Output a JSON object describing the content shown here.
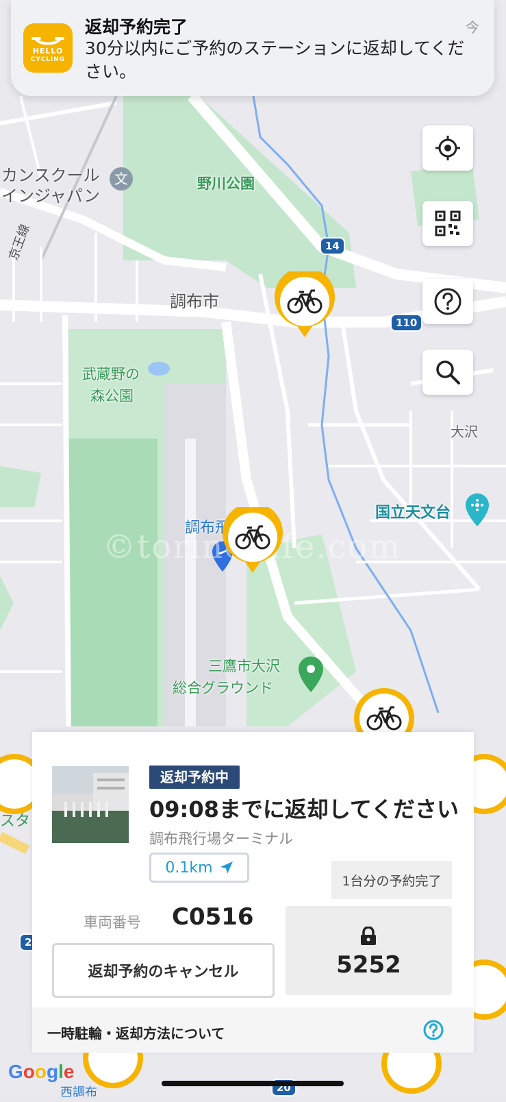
{
  "notification": {
    "title": "返却予約完了",
    "body": "30分以内にご予約のステーションに返却してください。",
    "time": "今",
    "app_icon_text_1": "HELLO",
    "app_icon_text_2": "CYCLING"
  },
  "map": {
    "labels": {
      "school_1": "カンスクール",
      "school_2": "インジャパン",
      "park_nogawa": "野川公園",
      "city_chofu": "調布市",
      "park_musashino_1": "武蔵野の",
      "park_musashino_2": "森公園",
      "osawa": "大沢",
      "observatory": "国立天文台",
      "airport": "調布飛",
      "ground_1": "三鷹市大沢",
      "ground_2": "総合グラウンド",
      "line": "京王線",
      "nishichofu": "西調布",
      "sta": "スタ"
    },
    "road_badges": [
      "14",
      "110",
      "2",
      "20"
    ],
    "google_logo": "Google",
    "watermark": "©torino-life.com"
  },
  "map_buttons": [
    {
      "icon": "location-icon"
    },
    {
      "icon": "qr-code-icon"
    },
    {
      "icon": "help-icon"
    },
    {
      "icon": "search-icon"
    }
  ],
  "card": {
    "status": "返却予約中",
    "deadline": "09:08までに返却してください",
    "station": "調布飛行場ターミナル",
    "distance": "0.1km",
    "reserve_badge": "1台分の予約完了",
    "vehicle_label": "車両番号",
    "vehicle_number": "C0516",
    "cancel_button": "返却予約のキャンセル",
    "lock_code": "5252",
    "info_link": "一時駐輪・返却方法について"
  },
  "colors": {
    "accent_yellow": "#f6b400",
    "status_navy": "#2c4a78",
    "link_blue": "#1e9bd0"
  }
}
